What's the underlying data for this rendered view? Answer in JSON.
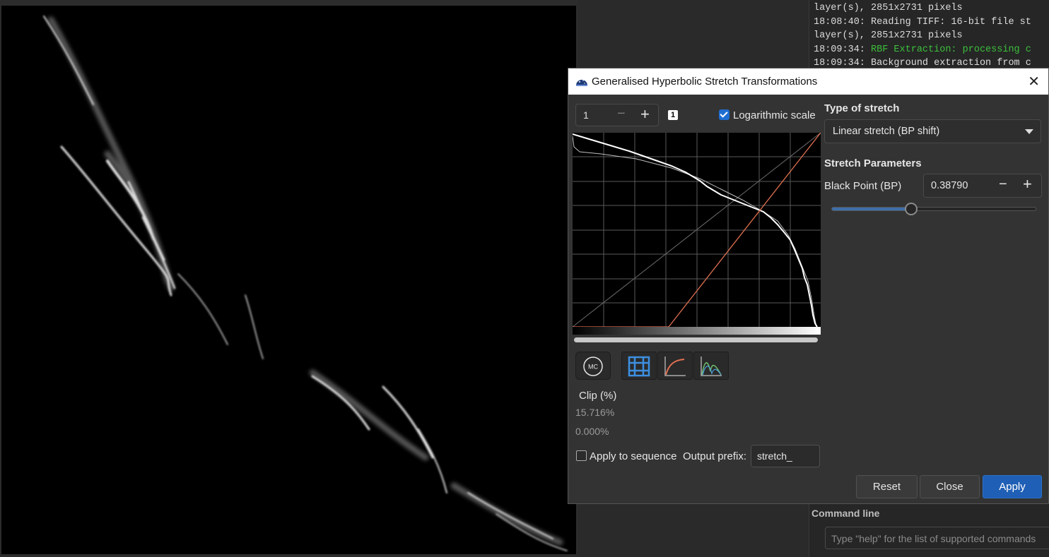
{
  "console": {
    "log_lines": [
      {
        "text": "layer(s), 2851x2731 pixels",
        "color": "default"
      },
      {
        "text": "18:08:40: Reading TIFF: 16-bit file st",
        "color": "default"
      },
      {
        "text": "layer(s), 2851x2731 pixels",
        "color": "default"
      },
      {
        "text": "18:09:34: RBF Extraction: processing c",
        "color": "green"
      },
      {
        "text": "18:09:34: Background extraction from c",
        "color": "default"
      }
    ],
    "command_line_label": "Command line",
    "command_placeholder": "Type \"help\" for the list of supported commands"
  },
  "dialog": {
    "title": "Generalised Hyperbolic Stretch Transformations",
    "zoom_value": "1",
    "channel_badge": "1",
    "log_scale_label": "Logarithmic scale",
    "log_scale_checked": true,
    "mc_label": "MC",
    "clip_label": "Clip (%)",
    "clip_low": "15.716%",
    "clip_high": "0.000%",
    "apply_to_sequence_label": "Apply to sequence",
    "apply_to_sequence_checked": false,
    "output_prefix_label": "Output prefix:",
    "output_prefix_value": "stretch_",
    "type_of_stretch_label": "Type of stretch",
    "type_of_stretch_value": "Linear stretch (BP shift)",
    "stretch_parameters_label": "Stretch Parameters",
    "black_point_label": "Black Point (BP)",
    "black_point_value": "0.38790",
    "black_point_fraction": 0.3879,
    "buttons": {
      "reset": "Reset",
      "close": "Close",
      "apply": "Apply"
    }
  },
  "colors": {
    "accent": "#1f5fb5",
    "transfer_curve": "#e07050",
    "log_green": "#3cbf3c"
  }
}
